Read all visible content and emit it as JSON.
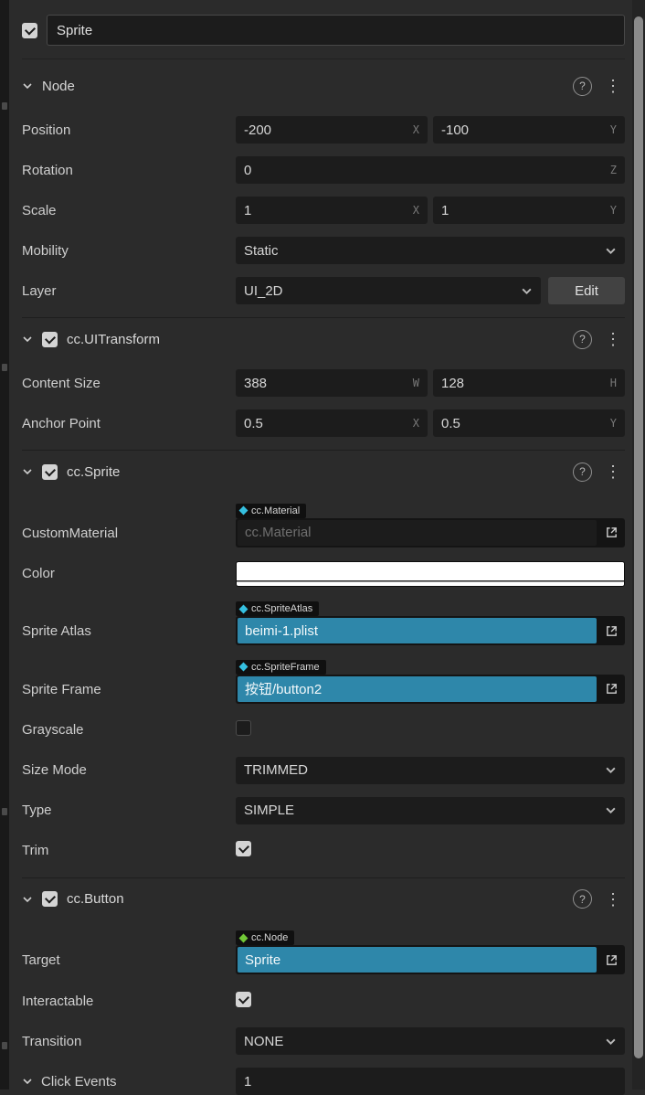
{
  "colors": {
    "accent": "#2e87aa",
    "asset_diamond": "#35c0e0",
    "node_diamond": "#71c837",
    "color_value": "#ffffff"
  },
  "icons": {
    "help": "?",
    "menu": "⋮"
  },
  "header": {
    "name": "Sprite"
  },
  "node": {
    "title": "Node",
    "position": {
      "label": "Position",
      "x": "-200",
      "y": "-100",
      "x_suffix": "X",
      "y_suffix": "Y"
    },
    "rotation": {
      "label": "Rotation",
      "z": "0",
      "z_suffix": "Z"
    },
    "scale": {
      "label": "Scale",
      "x": "1",
      "y": "1",
      "x_suffix": "X",
      "y_suffix": "Y"
    },
    "mobility": {
      "label": "Mobility",
      "value": "Static"
    },
    "layer": {
      "label": "Layer",
      "value": "UI_2D",
      "edit": "Edit"
    }
  },
  "uitransform": {
    "title": "cc.UITransform",
    "content_size": {
      "label": "Content Size",
      "w": "388",
      "h": "128",
      "w_suffix": "W",
      "h_suffix": "H"
    },
    "anchor_point": {
      "label": "Anchor Point",
      "x": "0.5",
      "y": "0.5",
      "x_suffix": "X",
      "y_suffix": "Y"
    }
  },
  "sprite": {
    "title": "cc.Sprite",
    "custom_material": {
      "label": "CustomMaterial",
      "tag": "cc.Material",
      "placeholder": "cc.Material"
    },
    "color": {
      "label": "Color",
      "value": "#ffffff"
    },
    "sprite_atlas": {
      "label": "Sprite Atlas",
      "tag": "cc.SpriteAtlas",
      "value": "beimi-1.plist"
    },
    "sprite_frame": {
      "label": "Sprite Frame",
      "tag": "cc.SpriteFrame",
      "value": "按钮/button2"
    },
    "grayscale": {
      "label": "Grayscale",
      "checked": false
    },
    "size_mode": {
      "label": "Size Mode",
      "value": "TRIMMED"
    },
    "type": {
      "label": "Type",
      "value": "SIMPLE"
    },
    "trim": {
      "label": "Trim",
      "checked": true
    }
  },
  "button": {
    "title": "cc.Button",
    "target": {
      "label": "Target",
      "tag": "cc.Node",
      "value": "Sprite"
    },
    "interactable": {
      "label": "Interactable",
      "checked": true
    },
    "transition": {
      "label": "Transition",
      "value": "NONE"
    },
    "click_events": {
      "label": "Click Events",
      "value": "1"
    }
  }
}
